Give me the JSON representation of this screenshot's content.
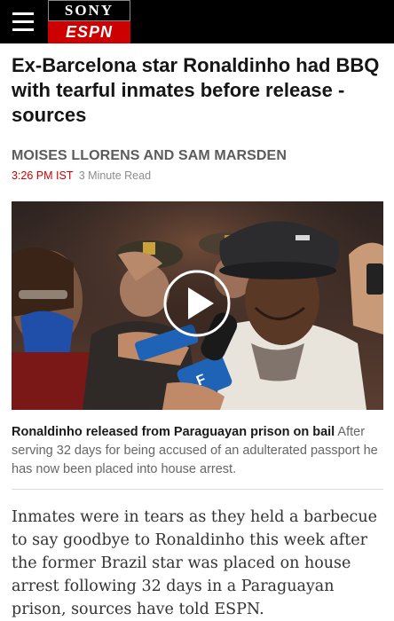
{
  "header": {
    "menu_icon": "hamburger-menu-icon",
    "logo_top": "SONY",
    "logo_bottom": "ESPN",
    "colors": {
      "bar": "#000000",
      "espn_red": "#cc0000"
    }
  },
  "article": {
    "headline": "Ex-Barcelona star Ronaldinho had BBQ with tearful inmates before release - sources",
    "byline": "MOISES LLORENS AND SAM MARSDEN",
    "time": "3:26 PM IST",
    "read_time": "3 Minute Read",
    "video": {
      "play_icon": "play-icon",
      "caption_title": "Ronaldinho released from Paraguayan prison on bail",
      "caption_text": "After serving 32 days for being accused of an adulterated passport he has now been placed into house arrest."
    },
    "body": "Inmates were in tears as they held a barbecue to say goodbye to Ronaldinho this week after the former Brazil star was placed on house arrest following 32 days in a Paraguayan prison, sources have told ESPN."
  }
}
